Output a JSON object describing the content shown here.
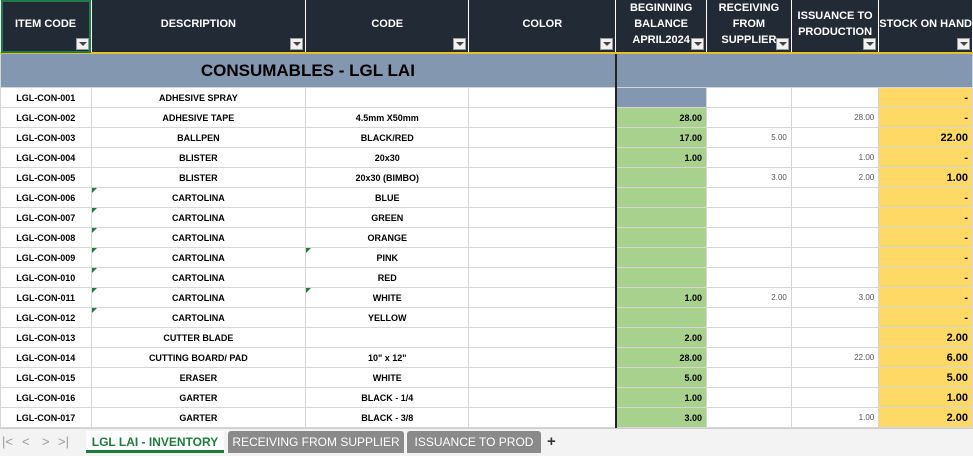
{
  "columns": [
    {
      "label": "ITEM CODE"
    },
    {
      "label": "DESCRIPTION"
    },
    {
      "label": "CODE"
    },
    {
      "label": "COLOR"
    },
    {
      "label": "BEGINNING BALANCE APRIL2024"
    },
    {
      "label": "RECEIVING FROM SUPPLIER"
    },
    {
      "label": "ISSUANCE TO PRODUCTION"
    },
    {
      "label": "STOCK ON HAND"
    }
  ],
  "section_title": "CONSUMABLES - LGL LAI",
  "rows": [
    {
      "item_code": "LGL-CON-001",
      "description": "ADHESIVE SPRAY",
      "code": "",
      "color": "",
      "beginning": "",
      "receiving": "",
      "issuance": "",
      "stock": "-"
    },
    {
      "item_code": "LGL-CON-002",
      "description": "ADHESIVE TAPE",
      "code": "4.5mm X50mm",
      "color": "",
      "beginning": "28.00",
      "receiving": "",
      "issuance": "28.00",
      "stock": "-"
    },
    {
      "item_code": "LGL-CON-003",
      "description": "BALLPEN",
      "code": "BLACK/RED",
      "color": "",
      "beginning": "17.00",
      "receiving": "5.00",
      "issuance": "",
      "stock": "22.00"
    },
    {
      "item_code": "LGL-CON-004",
      "description": "BLISTER",
      "code": "20x30",
      "color": "",
      "beginning": "1.00",
      "receiving": "",
      "issuance": "1.00",
      "stock": "-"
    },
    {
      "item_code": "LGL-CON-005",
      "description": "BLISTER",
      "code": "20x30 (BIMBO)",
      "color": "",
      "beginning": "",
      "receiving": "3.00",
      "issuance": "2.00",
      "stock": "1.00"
    },
    {
      "item_code": "LGL-CON-006",
      "description": "CARTOLINA",
      "code": "BLUE",
      "color": "",
      "beginning": "",
      "receiving": "",
      "issuance": "",
      "stock": "-"
    },
    {
      "item_code": "LGL-CON-007",
      "description": "CARTOLINA",
      "code": "GREEN",
      "color": "",
      "beginning": "",
      "receiving": "",
      "issuance": "",
      "stock": "-"
    },
    {
      "item_code": "LGL-CON-008",
      "description": "CARTOLINA",
      "code": "ORANGE",
      "color": "",
      "beginning": "",
      "receiving": "",
      "issuance": "",
      "stock": "-"
    },
    {
      "item_code": "LGL-CON-009",
      "description": "CARTOLINA",
      "code": "PINK",
      "color": "",
      "beginning": "",
      "receiving": "",
      "issuance": "",
      "stock": "-"
    },
    {
      "item_code": "LGL-CON-010",
      "description": "CARTOLINA",
      "code": "RED",
      "color": "",
      "beginning": "",
      "receiving": "",
      "issuance": "",
      "stock": "-"
    },
    {
      "item_code": "LGL-CON-011",
      "description": "CARTOLINA",
      "code": "WHITE",
      "color": "",
      "beginning": "1.00",
      "receiving": "2.00",
      "issuance": "3.00",
      "stock": "-"
    },
    {
      "item_code": "LGL-CON-012",
      "description": "CARTOLINA",
      "code": "YELLOW",
      "color": "",
      "beginning": "",
      "receiving": "",
      "issuance": "",
      "stock": "-"
    },
    {
      "item_code": "LGL-CON-013",
      "description": "CUTTER BLADE",
      "code": "",
      "color": "",
      "beginning": "2.00",
      "receiving": "",
      "issuance": "",
      "stock": "2.00"
    },
    {
      "item_code": "LGL-CON-014",
      "description": "CUTTING BOARD/ PAD",
      "code": "10\" x 12\"",
      "color": "",
      "beginning": "28.00",
      "receiving": "",
      "issuance": "22.00",
      "stock": "6.00"
    },
    {
      "item_code": "LGL-CON-015",
      "description": "ERASER",
      "code": "WHITE",
      "color": "",
      "beginning": "5.00",
      "receiving": "",
      "issuance": "",
      "stock": "5.00"
    },
    {
      "item_code": "LGL-CON-016",
      "description": "GARTER",
      "code": "BLACK - 1/4",
      "color": "",
      "beginning": "1.00",
      "receiving": "",
      "issuance": "",
      "stock": "1.00"
    },
    {
      "item_code": "LGL-CON-017",
      "description": "GARTER",
      "code": "BLACK - 3/8",
      "color": "",
      "beginning": "3.00",
      "receiving": "",
      "issuance": "1.00",
      "stock": "2.00"
    }
  ],
  "tabs": [
    {
      "label": "LGL LAI - INVENTORY",
      "active": true
    },
    {
      "label": "RECEIVING FROM SUPPLIER",
      "active": false
    },
    {
      "label": "ISSUANCE TO PROD",
      "active": false
    }
  ],
  "nav": {
    "first": "|<",
    "prev": "<",
    "next": ">",
    "last": ">|",
    "add": "+"
  },
  "colors": {
    "header_bg": "#222b35",
    "section_bg": "#8497b0",
    "beginning_bg": "#a9d18e",
    "stock_bg": "#ffd966",
    "accent": "#1e7b3c"
  }
}
